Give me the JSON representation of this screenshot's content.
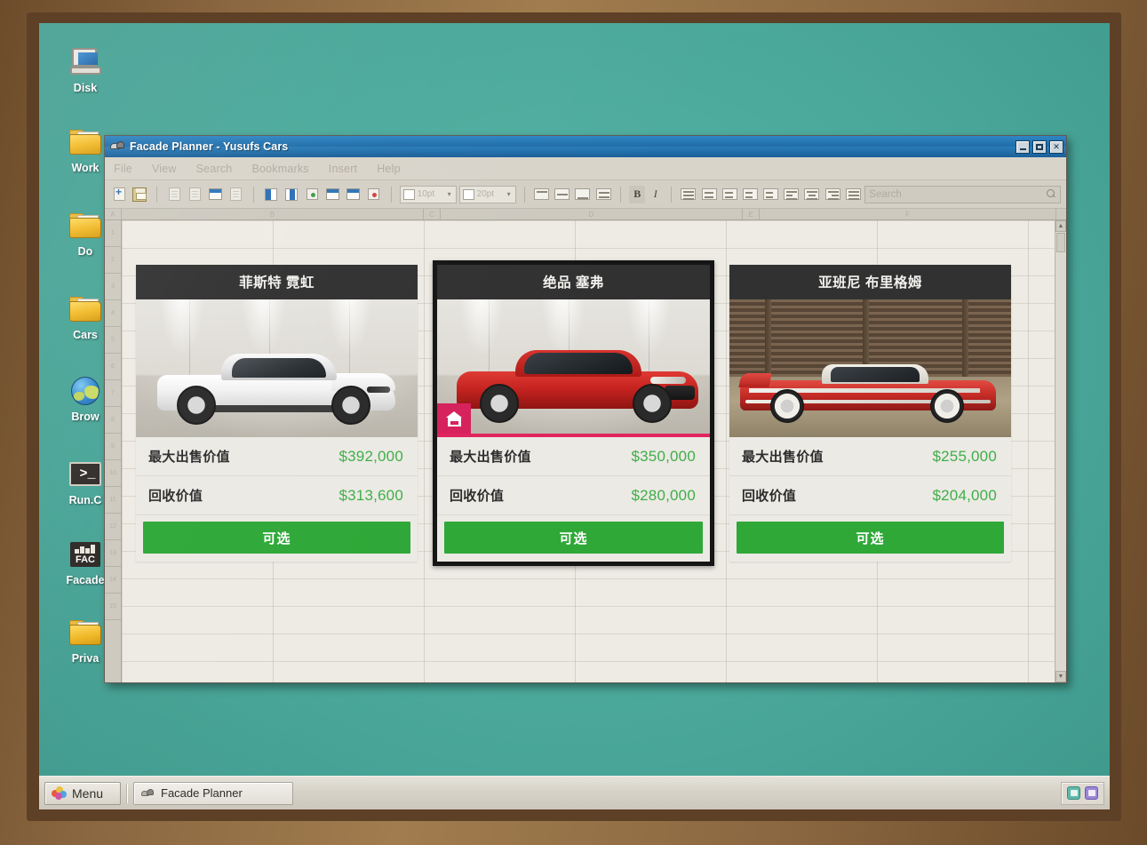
{
  "desktop": {
    "icons": [
      {
        "label": "Disk",
        "icon": "computer-icon"
      },
      {
        "label": "Work",
        "icon": "folder-icon"
      },
      {
        "label": "Do",
        "icon": "folder-icon"
      },
      {
        "label": "Cars",
        "icon": "folder-icon"
      },
      {
        "label": "Brow",
        "icon": "globe-icon"
      },
      {
        "label": "Run.C",
        "icon": "terminal-icon"
      },
      {
        "label": "Facade",
        "icon": "facade-app-icon"
      },
      {
        "label": "Priva",
        "icon": "folder-icon"
      }
    ],
    "background_color": "#4aa89a"
  },
  "window": {
    "title": "Facade Planner - Yusufs Cars",
    "title_icon": "cars-icon",
    "controls": {
      "minimize": "_",
      "maximize": "□",
      "close": "✕"
    },
    "menu": [
      "File",
      "View",
      "Search",
      "Bookmarks",
      "Insert",
      "Help"
    ],
    "toolbar": {
      "search_placeholder": "Search",
      "search_value": "",
      "font_value": "10pt",
      "size_value": "20pt",
      "bold_label": "B",
      "italic_label": "I"
    }
  },
  "sheet": {
    "columns": [
      "A",
      "B",
      "C",
      "D",
      "E",
      "F"
    ],
    "rows": [
      "1",
      "2",
      "3",
      "4",
      "5",
      "6",
      "7",
      "8",
      "9",
      "10",
      "11",
      "12",
      "13",
      "14",
      "15"
    ]
  },
  "cards": [
    {
      "name": "菲斯特 霓虹",
      "selected": false,
      "owned": false,
      "image": "white-sports-car",
      "stats": [
        {
          "label": "最大出售价值",
          "value": "$392,000"
        },
        {
          "label": "回收价值",
          "value": "$313,600"
        }
      ],
      "cta": "可选"
    },
    {
      "name": "绝品 塞弗",
      "selected": true,
      "owned": true,
      "image": "red-sedan",
      "badge_icon": "garage-house-icon",
      "stats": [
        {
          "label": "最大出售价值",
          "value": "$350,000"
        },
        {
          "label": "回收价值",
          "value": "$280,000"
        }
      ],
      "cta": "可选"
    },
    {
      "name": "亚班尼 布里格姆",
      "selected": false,
      "owned": false,
      "image": "red-vintage-convertible",
      "stats": [
        {
          "label": "最大出售价值",
          "value": "$255,000"
        },
        {
          "label": "回收价值",
          "value": "$204,000"
        }
      ],
      "cta": "可选"
    }
  ],
  "taskbar": {
    "menu_label": "Menu",
    "task_label": "Facade Planner",
    "tray": [
      "display-icon",
      "volume-icon"
    ]
  },
  "colors": {
    "title_blue": "#1f6ca8",
    "price_green": "#3fae4a",
    "cta_green": "#2fa838",
    "badge_pink": "#d6215c",
    "desktop_teal": "#4aa89a"
  }
}
